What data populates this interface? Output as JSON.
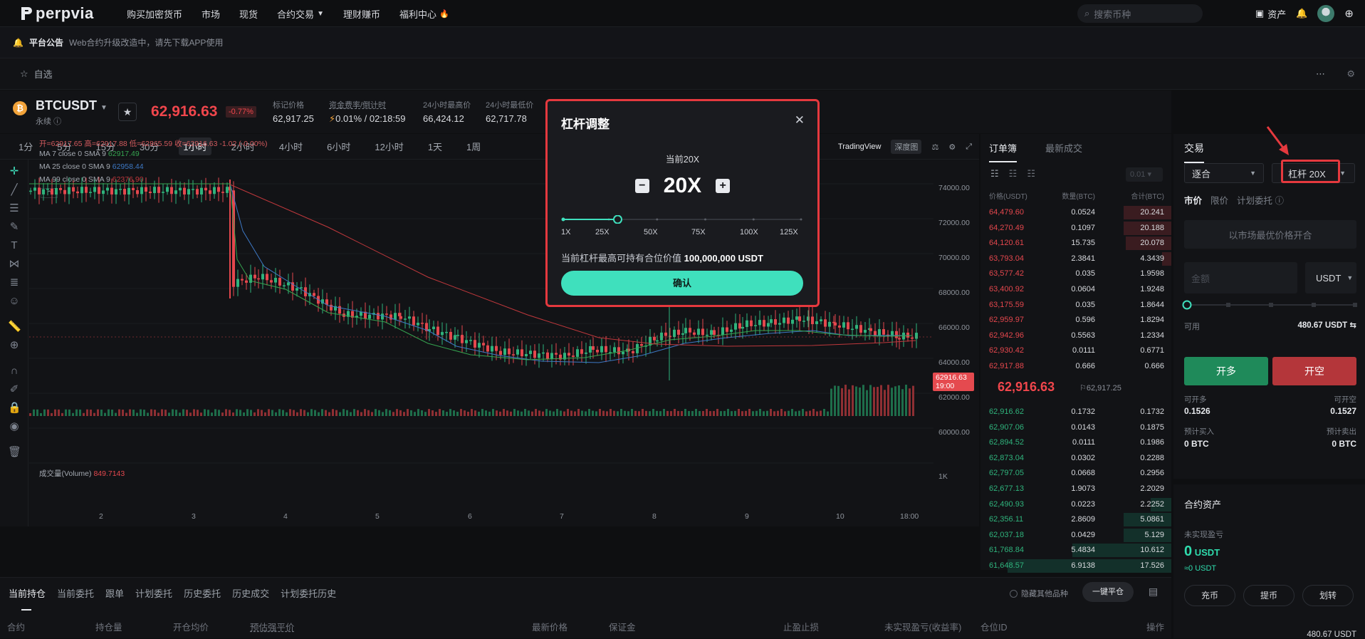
{
  "nav": {
    "logo": "perpvia",
    "items": [
      {
        "label": "购买加密货币"
      },
      {
        "label": "市场"
      },
      {
        "label": "现货"
      },
      {
        "label": "合约交易"
      },
      {
        "label": "理财赚币"
      },
      {
        "label": "福利中心"
      }
    ],
    "search_placeholder": "搜索币种",
    "assets_label": "资产"
  },
  "announcement": {
    "title": "平台公告",
    "text": "Web合约升级改造中，请先下载APP使用"
  },
  "favorites": {
    "label": "自选"
  },
  "ticker": {
    "pair": "BTCUSDT",
    "type": "永续",
    "price": "62,916.63",
    "change": "-0.77%",
    "stats": [
      {
        "label": "标记价格",
        "value": "62,917.25"
      },
      {
        "label": "资金费率/倒计时",
        "value": "0.01% / 02:18:59"
      },
      {
        "label": "24小时最高价",
        "value": "66,424.12"
      },
      {
        "label": "24小时最低价",
        "value": "62,717.78"
      }
    ]
  },
  "chart": {
    "timeframes": [
      "1分",
      "5分",
      "15分",
      "30分",
      "1小时",
      "2小时",
      "4小时",
      "6小时",
      "12小时",
      "1天",
      "1周"
    ],
    "active_timeframe": "1小时",
    "views": [
      "TradingView",
      "深度图"
    ],
    "ohlc": "开=62917.65 高=62917.88 低=62865.59 收=62916.63 -1.02 (-0.00%)",
    "ma7_label": "MA 7 close 0 SMA 9",
    "ma7_value": "62917.49",
    "ma25_label": "MA 25 close 0 SMA 9",
    "ma25_value": "62958.44",
    "ma99_label": "MA 99 close 0 SMA 9",
    "ma99_value": "62376.90",
    "volume_label": "成交量(Volume)",
    "volume_value": "849.7143",
    "y_ticks": [
      "74000.00",
      "72000.00",
      "70000.00",
      "68000.00",
      "66000.00",
      "64000.00",
      "62000.00",
      "60000.00"
    ],
    "volume_tick": "1K",
    "x_ticks": [
      "2",
      "3",
      "4",
      "5",
      "6",
      "7",
      "8",
      "9",
      "10",
      "18:00"
    ],
    "last_price_tag": "62916.63",
    "last_time_tag": "19:00",
    "colors": {
      "up": "#2fb37c",
      "down": "#e4474d",
      "ma7": "#35a34f",
      "ma25": "#3d78c4",
      "ma99": "#c0383c"
    }
  },
  "orderbook": {
    "tabs": [
      "订单簿",
      "最新成交"
    ],
    "precision": "0.01",
    "headers": [
      "价格(USDT)",
      "数量(BTC)",
      "合计(BTC)"
    ],
    "asks": [
      {
        "price": "64,479.60",
        "qty": "0.0524",
        "sum": "20.241",
        "depth": 0.25
      },
      {
        "price": "64,270.49",
        "qty": "0.1097",
        "sum": "20.188",
        "depth": 0.25
      },
      {
        "price": "64,120.61",
        "qty": "15.735",
        "sum": "20.078",
        "depth": 0.24
      },
      {
        "price": "63,793.04",
        "qty": "2.3841",
        "sum": "4.3439",
        "depth": 0.05
      },
      {
        "price": "63,577.42",
        "qty": "0.035",
        "sum": "1.9598",
        "depth": 0.0
      },
      {
        "price": "63,400.92",
        "qty": "0.0604",
        "sum": "1.9248",
        "depth": 0.0
      },
      {
        "price": "63,175.59",
        "qty": "0.035",
        "sum": "1.8644",
        "depth": 0.0
      },
      {
        "price": "62,959.97",
        "qty": "0.596",
        "sum": "1.8294",
        "depth": 0.0
      },
      {
        "price": "62,942.96",
        "qty": "0.5563",
        "sum": "1.2334",
        "depth": 0.0
      },
      {
        "price": "62,930.42",
        "qty": "0.0111",
        "sum": "0.6771",
        "depth": 0.0
      },
      {
        "price": "62,917.88",
        "qty": "0.666",
        "sum": "0.666",
        "depth": 0.0
      }
    ],
    "mid_price": "62,916.63",
    "mark_price": "62,917.25",
    "bids": [
      {
        "price": "62,916.62",
        "qty": "0.1732",
        "sum": "0.1732",
        "depth": 0.0
      },
      {
        "price": "62,907.06",
        "qty": "0.0143",
        "sum": "0.1875",
        "depth": 0.0
      },
      {
        "price": "62,894.52",
        "qty": "0.0111",
        "sum": "0.1986",
        "depth": 0.0
      },
      {
        "price": "62,873.04",
        "qty": "0.0302",
        "sum": "0.2288",
        "depth": 0.0
      },
      {
        "price": "62,797.05",
        "qty": "0.0668",
        "sum": "0.2956",
        "depth": 0.0
      },
      {
        "price": "62,677.13",
        "qty": "1.9073",
        "sum": "2.2029",
        "depth": 0.0
      },
      {
        "price": "62,490.93",
        "qty": "0.0223",
        "sum": "2.2252",
        "depth": 0.11
      },
      {
        "price": "62,356.11",
        "qty": "2.8609",
        "sum": "5.0861",
        "depth": 0.25
      },
      {
        "price": "62,037.18",
        "qty": "0.0429",
        "sum": "5.129",
        "depth": 0.25
      },
      {
        "price": "61,768.84",
        "qty": "5.4834",
        "sum": "10.612",
        "depth": 0.52
      },
      {
        "price": "61,648.57",
        "qty": "6.9138",
        "sum": "17.526",
        "depth": 0.86
      }
    ]
  },
  "trade": {
    "title": "交易",
    "margin_mode": "逐合",
    "leverage": "杠杆 20X",
    "order_types": [
      "市价",
      "限价",
      "计划委托"
    ],
    "market_placeholder": "以市场最优价格开合",
    "amount_placeholder": "金额",
    "unit": "USDT",
    "available_label": "可用",
    "available_value": "480.67 USDT",
    "long_label": "开多",
    "short_label": "开空",
    "can_open_long_label": "可开多",
    "can_open_long": "0.1526",
    "can_open_short_label": "可开空",
    "can_open_short": "0.1527",
    "est_buy_label": "预计买入",
    "est_buy": "0 BTC",
    "est_sell_label": "预计卖出",
    "est_sell": "0 BTC",
    "assets_title": "合约资产",
    "unrealized_label": "未实现盈亏",
    "unrealized_value": "0",
    "unrealized_unit": "USDT",
    "unrealized_approx": "≈0 USDT",
    "asset_buttons": [
      "充币",
      "提币",
      "划转"
    ],
    "bottom_value": "480.67 USDT"
  },
  "positions": {
    "tabs": [
      "当前持仓",
      "当前委托",
      "跟单",
      "计划委托",
      "历史委托",
      "历史成交",
      "计划委托历史"
    ],
    "active_tab": "当前持仓",
    "hide_other": "隐藏其他品种",
    "close_all": "一键平仓",
    "columns": [
      "合约",
      "持仓量",
      "开仓均价",
      "预估强平价",
      "最新价格",
      "保证金",
      "止盈止损",
      "未实现盈亏(收益率)",
      "仓位ID",
      "操作"
    ]
  },
  "modal": {
    "title": "杠杆调整",
    "current": "当前20X",
    "value": "20X",
    "min": 1,
    "max": 125,
    "selected": 20,
    "ticks": [
      "1X",
      "25X",
      "50X",
      "75X",
      "100X",
      "125X"
    ],
    "max_position_label": "当前杠杆最高可持有合位价值",
    "max_position_value": "100,000,000 USDT",
    "confirm": "确认",
    "accent": "#3fe0bd"
  }
}
